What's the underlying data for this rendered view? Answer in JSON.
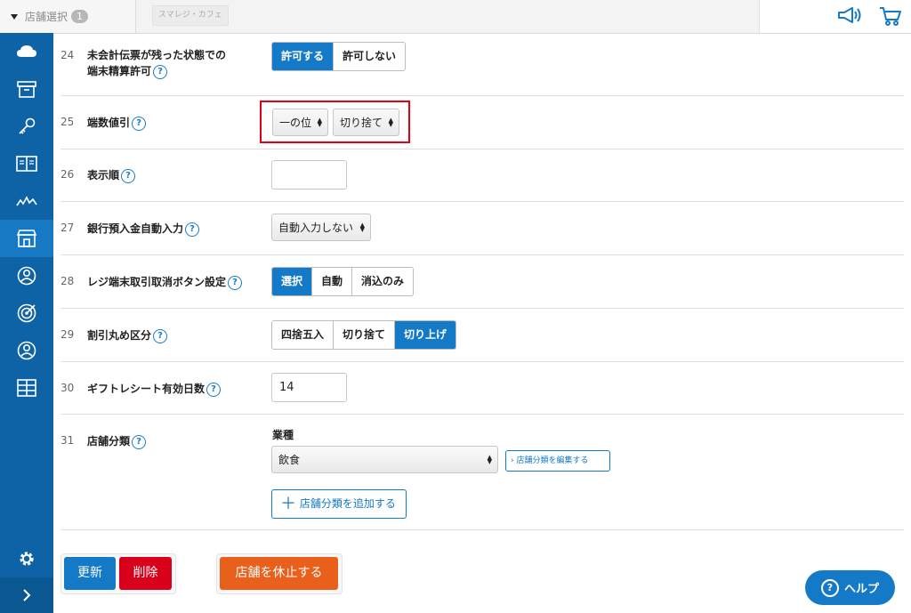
{
  "topbar": {
    "store_select_label": "店舗選択",
    "store_select_count": "1",
    "tenant_name": "スマレジ・カフェ"
  },
  "sidebar": {
    "items": [
      {
        "icon": "cloud-icon"
      },
      {
        "icon": "archive-box-icon"
      },
      {
        "icon": "key-icon"
      },
      {
        "icon": "book-icon"
      },
      {
        "icon": "line-chart-icon"
      },
      {
        "icon": "store-icon",
        "active": true
      },
      {
        "icon": "user-circle-icon"
      },
      {
        "icon": "target-icon"
      },
      {
        "icon": "user-circle-icon"
      },
      {
        "icon": "grid-table-icon"
      }
    ],
    "settings_icon": "gear-icon",
    "expand_icon": "chevron-right-icon"
  },
  "rows": [
    {
      "num": "24",
      "label_line1": "未会計伝票が残った状態での",
      "label_line2": "端末精算許可",
      "options": [
        "許可する",
        "許可しない"
      ],
      "selected": 0
    },
    {
      "num": "25",
      "label": "端数値引",
      "select1": "一の位",
      "select2": "切り捨て"
    },
    {
      "num": "26",
      "label": "表示順",
      "value": ""
    },
    {
      "num": "27",
      "label": "銀行預入金自動入力",
      "select": "自動入力しない"
    },
    {
      "num": "28",
      "label": "レジ端末取引取消ボタン設定",
      "options": [
        "選択",
        "自動",
        "消込のみ"
      ],
      "selected": 0
    },
    {
      "num": "29",
      "label": "割引丸め区分",
      "options": [
        "四捨五入",
        "切り捨て",
        "切り上げ"
      ],
      "selected": 2
    },
    {
      "num": "30",
      "label": "ギフトレシート有効日数",
      "value": "14"
    },
    {
      "num": "31",
      "label": "店舗分類",
      "sub_label": "業種",
      "select": "飲食",
      "edit_button": "店舗分類を編集する",
      "add_button": "店舗分類を追加する"
    }
  ],
  "help_glyph": "?",
  "footer": {
    "update": "更新",
    "delete": "削除",
    "suspend": "店舗を休止する",
    "help": "ヘルプ"
  },
  "colors": {
    "primary": "#1479c6",
    "sidebar": "#0e63a6",
    "danger": "#d9001b",
    "warning": "#e8601c",
    "highlight": "#e4000f"
  }
}
